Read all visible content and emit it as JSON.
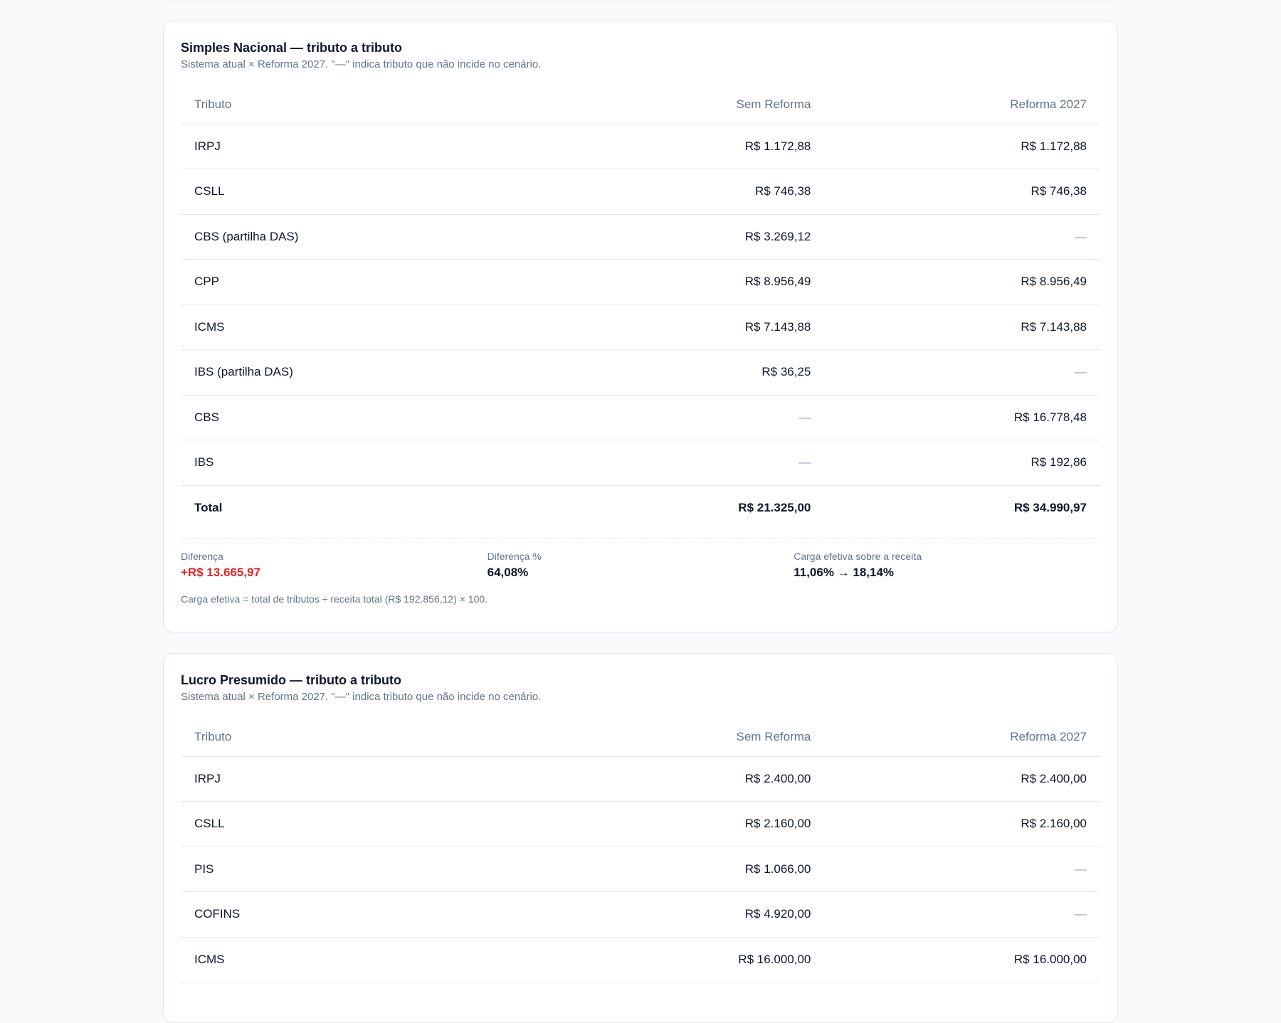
{
  "simples": {
    "title": "Simples Nacional — tributo a tributo",
    "subtitle": "Sistema atual × Reforma 2027. \"—\" indica tributo que não incide no cenário.",
    "headers": {
      "tributo": "Tributo",
      "sem": "Sem Reforma",
      "reforma": "Reforma 2027"
    },
    "rows": [
      {
        "name": "IRPJ",
        "sem": "R$ 1.172,88",
        "reforma": "R$ 1.172,88"
      },
      {
        "name": "CSLL",
        "sem": "R$ 746,38",
        "reforma": "R$ 746,38"
      },
      {
        "name": "CBS (partilha DAS)",
        "sem": "R$ 3.269,12",
        "reforma": "—"
      },
      {
        "name": "CPP",
        "sem": "R$ 8.956,49",
        "reforma": "R$ 8.956,49"
      },
      {
        "name": "ICMS",
        "sem": "R$ 7.143,88",
        "reforma": "R$ 7.143,88"
      },
      {
        "name": "IBS (partilha DAS)",
        "sem": "R$ 36,25",
        "reforma": "—"
      },
      {
        "name": "CBS",
        "sem": "—",
        "reforma": "R$ 16.778,48"
      },
      {
        "name": "IBS",
        "sem": "—",
        "reforma": "R$ 192,86"
      }
    ],
    "total": {
      "name": "Total",
      "sem": "R$ 21.325,00",
      "reforma": "R$ 34.990,97"
    },
    "summary": {
      "diff_label": "Diferença",
      "diff_value": "+R$ 13.665,97",
      "diff_pct_label": "Diferença %",
      "diff_pct_value": "64,08%",
      "carga_label": "Carga efetiva sobre a receita",
      "carga_value": "11,06% → 18,14%"
    },
    "footnote": "Carga efetiva = total de tributos ÷ receita total (R$ 192.856,12) × 100.",
    "negative_color": "#dc2626"
  },
  "presumido": {
    "title": "Lucro Presumido — tributo a tributo",
    "subtitle": "Sistema atual × Reforma 2027. \"—\" indica tributo que não incide no cenário.",
    "headers": {
      "tributo": "Tributo",
      "sem": "Sem Reforma",
      "reforma": "Reforma 2027"
    },
    "rows": [
      {
        "name": "IRPJ",
        "sem": "R$ 2.400,00",
        "reforma": "R$ 2.400,00"
      },
      {
        "name": "CSLL",
        "sem": "R$ 2.160,00",
        "reforma": "R$ 2.160,00"
      },
      {
        "name": "PIS",
        "sem": "R$ 1.066,00",
        "reforma": "—"
      },
      {
        "name": "COFINS",
        "sem": "R$ 4.920,00",
        "reforma": "—"
      },
      {
        "name": "ICMS",
        "sem": "R$ 16.000,00",
        "reforma": "R$ 16.000,00"
      }
    ]
  }
}
